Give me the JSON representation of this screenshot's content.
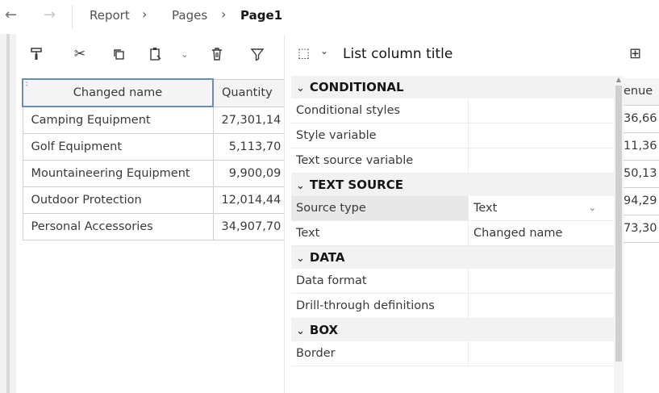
{
  "breadcrumb": {
    "items": [
      "Report",
      "Pages",
      "Page1"
    ]
  },
  "icons": {
    "back": "arrow-left-icon",
    "forward": "arrow-right-icon",
    "chevron": "chevron-right-icon"
  },
  "toolbar": {
    "buttons": [
      "paint-format-icon",
      "cut-icon",
      "copy-icon",
      "paste-icon",
      "delete-icon",
      "filter-icon"
    ]
  },
  "report_table": {
    "headers": [
      "Changed name",
      "Quantity"
    ],
    "rows": [
      [
        "Camping Equipment",
        "27,301,14"
      ],
      [
        "Golf Equipment",
        "5,113,70"
      ],
      [
        "Mountaineering Equipment",
        "9,900,09"
      ],
      [
        "Outdoor Protection",
        "12,014,44"
      ],
      [
        "Personal Accessories",
        "34,907,70"
      ]
    ]
  },
  "revenue_column": {
    "header": "enue",
    "values": [
      "36,66",
      "11,36",
      "50,13",
      "94,29",
      "73,30"
    ]
  },
  "panel": {
    "title": "List column title",
    "sections": [
      {
        "label": "CONDITIONAL",
        "rows": [
          {
            "key": "Conditional styles",
            "value": ""
          },
          {
            "key": "Style variable",
            "value": ""
          },
          {
            "key": "Text source variable",
            "value": ""
          }
        ]
      },
      {
        "label": "TEXT SOURCE",
        "rows": [
          {
            "key": "Source type",
            "value": "Text"
          },
          {
            "key": "Text",
            "value": "Changed name"
          }
        ]
      },
      {
        "label": "DATA",
        "rows": [
          {
            "key": "Data format",
            "value": ""
          },
          {
            "key": "Drill-through definitions",
            "value": ""
          }
        ]
      },
      {
        "label": "BOX",
        "rows": [
          {
            "key": "Border",
            "value": ""
          }
        ]
      }
    ]
  }
}
